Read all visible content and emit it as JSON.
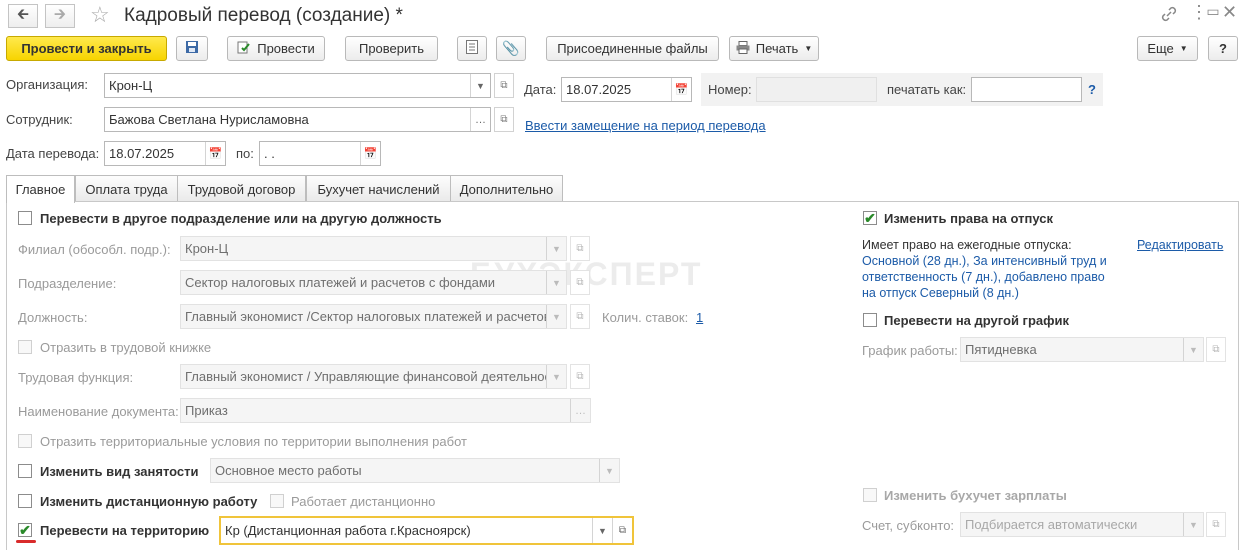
{
  "window": {
    "title": "Кадровый перевод (создание) *"
  },
  "toolbar": {
    "post_close": "Провести и закрыть",
    "post": "Провести",
    "check": "Проверить",
    "attached_files": "Присоединенные файлы",
    "print": "Печать",
    "more": "Еще",
    "help": "?"
  },
  "header": {
    "org_label": "Организация:",
    "org_value": "Крон-Ц",
    "date_label": "Дата:",
    "date_value": "18.07.2025",
    "number_label": "Номер:",
    "number_value": "",
    "print_as_label": "печатать как:",
    "print_as_value": "",
    "print_as_help": "?",
    "employee_label": "Сотрудник:",
    "employee_value": "Бажова Светлана Нурисламовна",
    "replacement_link": "Ввести замещение на период перевода",
    "transfer_date_label": "Дата перевода:",
    "transfer_date_value": "18.07.2025",
    "to_label": "по:",
    "to_value": " .  ."
  },
  "tabs": [
    {
      "label": "Главное"
    },
    {
      "label": "Оплата труда"
    },
    {
      "label": "Трудовой договор"
    },
    {
      "label": "Бухучет начислений"
    },
    {
      "label": "Дополнительно"
    }
  ],
  "main": {
    "transfer_dept_label": "Перевести в другое подразделение или на другую должность",
    "branch_label": "Филиал (обособл. подр.):",
    "branch_value": "Крон-Ц",
    "dept_label": "Подразделение:",
    "dept_value": "Сектор налоговых платежей и расчетов с фондами",
    "position_label": "Должность:",
    "position_value": "Главный экономист /Сектор налоговых платежей и расчетов",
    "rates_label": "Колич. ставок:",
    "rates_value": "1",
    "work_book_label": "Отразить в трудовой книжке",
    "labor_function_label": "Трудовая функция:",
    "labor_function_value": "Главный экономист / Управляющие финансовой деятельнос",
    "doc_name_label": "Наименование документа:",
    "doc_name_value": "Приказ",
    "territorial_label": "Отразить территориальные условия по территории выполнения работ",
    "employment_type_label": "Изменить вид занятости",
    "employment_type_value": "Основное место работы",
    "remote_label": "Изменить дистанционную работу",
    "remote_sub_label": "Работает дистанционно",
    "territory_label": "Перевести на территорию",
    "territory_value": "Кр (Дистанционная работа г.Красноярск)"
  },
  "right": {
    "vacation_label": "Изменить права на отпуск",
    "vacation_right_title": "Имеет право на ежегодные отпуска:",
    "vacation_edit": "Редактировать",
    "vacation_text_1": "Основной (28 дн.), За интенсивный труд и",
    "vacation_text_2": "ответственность (7 дн.), добавлено право",
    "vacation_text_3": "на отпуск Северный (8 дн.)",
    "schedule_label": "Перевести на другой график",
    "schedule_field_label": "График работы:",
    "schedule_value": "Пятидневка",
    "accounting_label": "Изменить бухучет зарплаты",
    "account_label": "Счет, субконто:",
    "account_value": "Подбирается автоматически"
  },
  "watermark": "БУХЭКСПЕРТ"
}
